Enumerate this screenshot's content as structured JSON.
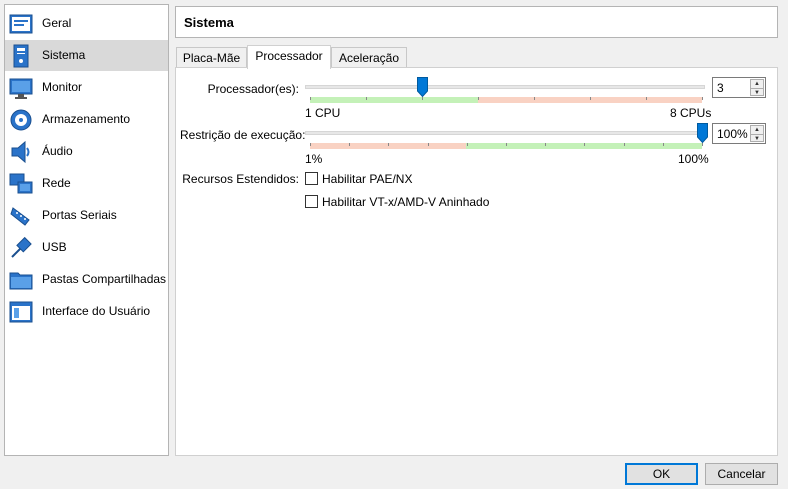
{
  "sidebar": {
    "items": [
      {
        "label": "Geral",
        "icon": "general-icon"
      },
      {
        "label": "Sistema",
        "icon": "system-icon",
        "selected": true
      },
      {
        "label": "Monitor",
        "icon": "monitor-icon"
      },
      {
        "label": "Armazenamento",
        "icon": "storage-icon"
      },
      {
        "label": "Áudio",
        "icon": "audio-icon"
      },
      {
        "label": "Rede",
        "icon": "network-icon"
      },
      {
        "label": "Portas Seriais",
        "icon": "serial-ports-icon"
      },
      {
        "label": "USB",
        "icon": "usb-icon"
      },
      {
        "label": "Pastas Compartilhadas",
        "icon": "shared-folders-icon"
      },
      {
        "label": "Interface do Usuário",
        "icon": "user-interface-icon"
      }
    ]
  },
  "header": {
    "title": "Sistema"
  },
  "tabs": [
    {
      "label": "Placa-Mãe"
    },
    {
      "label": "Processador",
      "active": true
    },
    {
      "label": "Aceleração"
    }
  ],
  "processor": {
    "label": "Processador(es):",
    "value": "3",
    "min_label": "1 CPU",
    "max_label": "8 CPUs",
    "min": 1,
    "max": 8,
    "current": 3
  },
  "execution_cap": {
    "label": "Restrição de execução:",
    "value": "100%",
    "min_label": "1%",
    "max_label": "100%",
    "min": 1,
    "max": 100,
    "current": 100
  },
  "extended": {
    "label": "Recursos Estendidos:",
    "pae_label": "Habilitar PAE/NX",
    "pae_checked": false,
    "vtx_label": "Habilitar VT-x/AMD-V Aninhado",
    "vtx_checked": false
  },
  "buttons": {
    "ok": "OK",
    "cancel": "Cancelar"
  },
  "colors": {
    "accent": "#0078d7",
    "zone_green": "#c4f1b8",
    "zone_red": "#f9d2c3",
    "selected_bg": "#d9d9d9"
  }
}
